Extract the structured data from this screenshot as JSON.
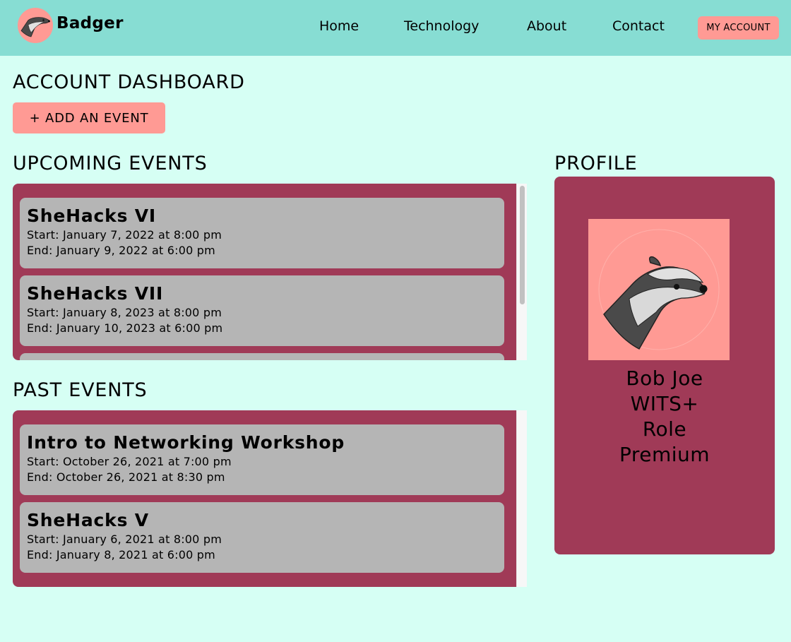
{
  "header": {
    "brand": "Badger",
    "nav": [
      "Home",
      "Technology",
      "About",
      "Contact"
    ],
    "account_button": "MY ACCOUNT"
  },
  "dashboard": {
    "title": "ACCOUNT DASHBOARD",
    "add_event_label": "+ ADD AN EVENT"
  },
  "upcoming": {
    "title": "UPCOMING EVENTS",
    "events": [
      {
        "name": "SheHacks VI",
        "start": "Start: January 7, 2022 at 8:00 pm",
        "end": "End: January 9, 2022 at 6:00 pm"
      },
      {
        "name": "SheHacks VII",
        "start": "Start: January 8, 2023 at 8:00 pm",
        "end": "End: January 10, 2023 at 6:00 pm"
      }
    ]
  },
  "past": {
    "title": "PAST EVENTS",
    "events": [
      {
        "name": "Intro to Networking Workshop",
        "start": "Start: October 26, 2021 at 7:00 pm",
        "end": "End: October 26, 2021 at 8:30 pm"
      },
      {
        "name": "SheHacks V",
        "start": "Start: January 6, 2021 at 8:00 pm",
        "end": "End: January 8, 2021 at 6:00 pm"
      }
    ]
  },
  "profile": {
    "title": "PROFILE",
    "name": "Bob Joe",
    "organization": "WITS+",
    "role": "Role",
    "tier": "Premium"
  },
  "colors": {
    "header_bg": "#87ddd3",
    "page_bg": "#d6fff4",
    "accent": "#ff9a94",
    "panel": "#a03a57",
    "card": "#b5b5b5"
  },
  "icons": {
    "logo": "badger-icon",
    "avatar": "badger-avatar-icon"
  }
}
